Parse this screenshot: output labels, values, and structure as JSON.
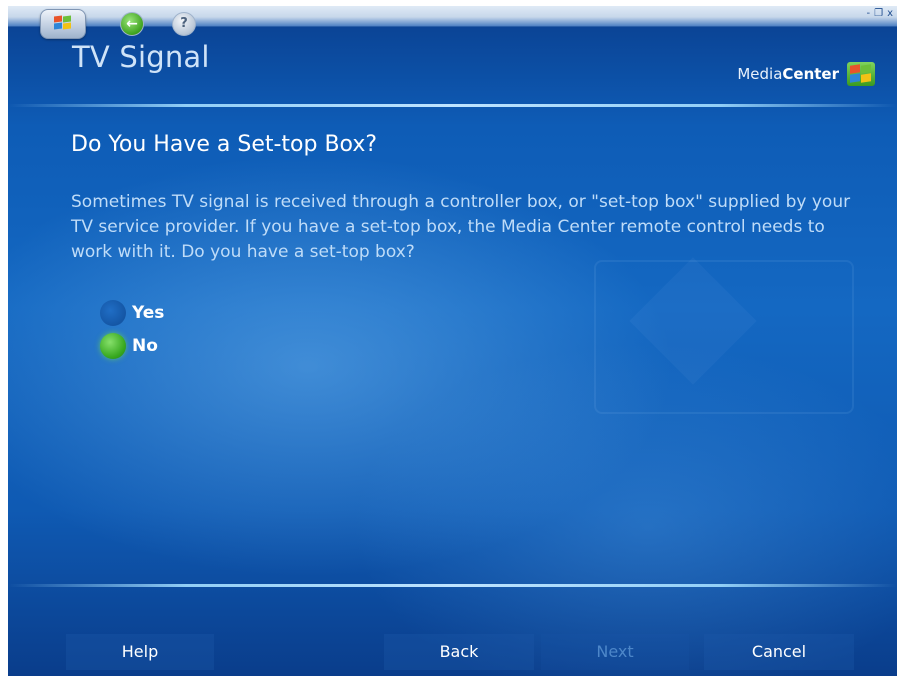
{
  "chrome": {
    "start_icon": "windows-flag-icon",
    "back_icon": "back-arrow-icon",
    "help_icon": "question-mark-icon",
    "window_controls": {
      "minimize": "-",
      "restore": "❐",
      "close": "x"
    }
  },
  "header": {
    "title": "TV Signal",
    "brand_light": "Media",
    "brand_bold": "Center"
  },
  "main": {
    "heading": "Do You Have a Set-top Box?",
    "description": "Sometimes TV signal is received through a controller box, or \"set-top box\" supplied by your TV service provider. If you have a set-top box, the Media Center remote control needs to work with it. Do you have a set-top box?",
    "options": [
      {
        "label": "Yes",
        "selected": false
      },
      {
        "label": "No",
        "selected": true
      }
    ]
  },
  "footer": {
    "help_label": "Help",
    "back_label": "Back",
    "next_label": "Next",
    "cancel_label": "Cancel",
    "next_enabled": false
  },
  "colors": {
    "background": "#1468c2",
    "selected_radio": "#37a81f",
    "text_primary": "#ffffff",
    "text_secondary": "#bfdcf8",
    "disabled_text": "#4d87c9"
  }
}
